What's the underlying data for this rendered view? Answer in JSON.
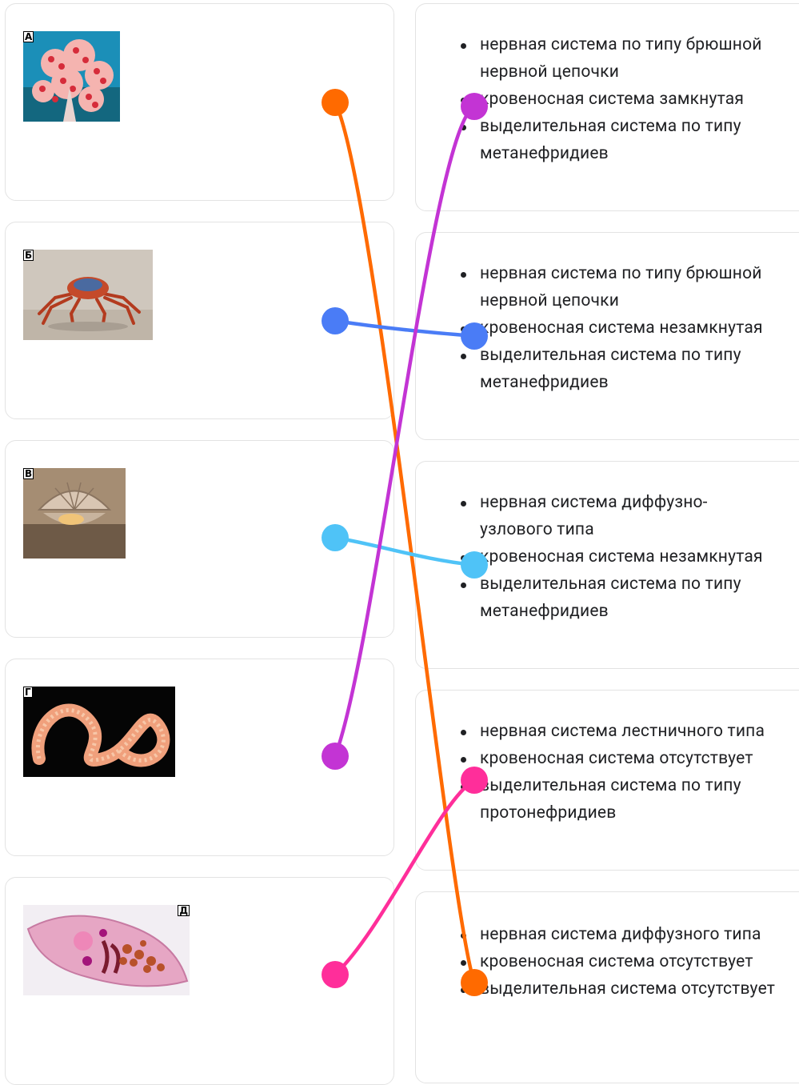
{
  "animals": [
    {
      "letter": "А",
      "image": "coral-photo"
    },
    {
      "letter": "Б",
      "image": "crab-photo"
    },
    {
      "letter": "В",
      "image": "scallop-photo"
    },
    {
      "letter": "Г",
      "image": "worm-photo"
    },
    {
      "letter": "Д",
      "image": "fluke-photo"
    }
  ],
  "options": [
    {
      "items": [
        "нервная система по типу брюшной нервной цепочки",
        "кровеносная система замкнутая",
        "выделительная система по типу метанефридиев"
      ]
    },
    {
      "items": [
        "нервная система по типу брюшной нервной цепочки",
        "кровеносная система незамкнутая",
        "выделительная система по типу метанефридиев"
      ]
    },
    {
      "items": [
        "нервная система диффузно-узлового типа",
        "кровеносная система незамкнутая",
        "выделительная система по типу метанефридиев"
      ]
    },
    {
      "items": [
        "нервная система лестничного типа",
        "кровеносная система отсутствует",
        "выделительная система по типу протонефридиев"
      ]
    },
    {
      "items": [
        "нервная система диффузного типа",
        "кровеносная система отсутствует",
        "выделительная система отсутствует"
      ]
    }
  ],
  "connections": [
    {
      "from": "А",
      "to_option": 5,
      "color": "#ff6a00"
    },
    {
      "from": "Б",
      "to_option": 2,
      "color": "#4a7cf6"
    },
    {
      "from": "В",
      "to_option": 3,
      "color": "#4fc3f7"
    },
    {
      "from": "Г",
      "to_option": 1,
      "color": "#c334d4"
    },
    {
      "from": "Д",
      "to_option": 4,
      "color": "#ff2e9a"
    }
  ]
}
